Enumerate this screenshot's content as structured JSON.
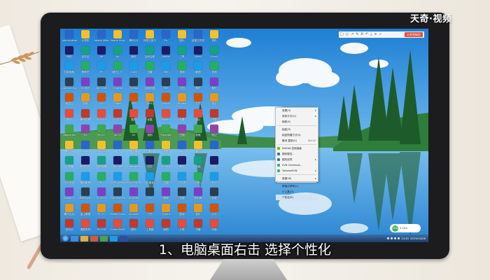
{
  "brand": {
    "logo_text": "天奇·视频"
  },
  "caption": "1、电脑桌面右击 选择个性化",
  "toolbar": {
    "share_label": "分享到微信"
  },
  "taskbar": {
    "clock_time": "14:45",
    "clock_date": "2019/10/26",
    "apps": [
      "ie",
      "explorer",
      "media",
      "chrome",
      "qq",
      "photoshop"
    ]
  },
  "widget": {
    "speed": "25%",
    "net": "0.1K/s"
  },
  "context_menu": {
    "items": [
      {
        "label": "查看(V)",
        "submenu": true
      },
      {
        "label": "排序方式(O)",
        "submenu": true
      },
      {
        "label": "刷新(E)"
      },
      {
        "sep": true
      },
      {
        "label": "粘贴(P)"
      },
      {
        "label": "粘贴快捷方式(S)"
      },
      {
        "label": "撤消 复制(U)",
        "shortcut": "Ctrl+Z"
      },
      {
        "sep": true
      },
      {
        "label": "NVIDIA 控制面板"
      },
      {
        "label": "图形属性..."
      },
      {
        "label": "图形选项",
        "submenu": true
      },
      {
        "label": "SVN Checkout..."
      },
      {
        "label": "TortoiseSVN",
        "submenu": true
      },
      {
        "sep": true
      },
      {
        "label": "新建(W)",
        "submenu": true
      },
      {
        "sep": true
      },
      {
        "label": "屏幕分辨率(C)"
      },
      {
        "label": "小工具(G)"
      },
      {
        "label": "个性化(R)",
        "highlight": true
      }
    ]
  },
  "desktop_icons": [
    "Administrator",
    "计算机",
    "Adobe After Effects",
    "Adobe Illustrator",
    "腾讯QQ",
    "网易云音乐",
    "Ps",
    "图标",
    "新建文件夹",
    "资料",
    "网络",
    "回收站",
    "Ae",
    "Au",
    "微信",
    "会声会影",
    "Adobe",
    "工具",
    "Word",
    "Excel",
    "控制面板",
    "爱奇艺",
    "Pr",
    "格式工厂",
    "CAD",
    "迅雷",
    "360",
    "视频",
    "截图",
    "音频",
    "Internet Explorer",
    "QQ音乐",
    "Ae 2018",
    "Chrome",
    "Firefox",
    "百度网盘",
    "PDF",
    "文档",
    "素材",
    "备份",
    "网易云",
    "剪映",
    "Ai",
    "Edge",
    "PPT",
    "WPS",
    "Xmind",
    "Photos",
    "文件",
    "项目",
    "微信",
    "腾讯视频",
    "Ps 2019",
    "Ai 2019",
    "酷狗",
    "优酷",
    "Steam",
    "设置",
    "图片",
    "下载",
    "Adobe Ae",
    "Ps",
    "Ps CC",
    "Au CC",
    "ID",
    "搜狗",
    "Foxmail",
    "压缩",
    "表格",
    "笔记",
    "腾讯QQ",
    "Premiere",
    "Word 2016",
    "格式",
    "爱剪辑",
    "芒果TV",
    "录屏",
    "演示",
    "课件",
    "临时",
    "计算器",
    "阿里旺旺",
    "视频编辑",
    "Animate",
    "Dreamweaver",
    "钉钉",
    "Camtasia",
    "教程",
    "电脑",
    "网盘",
    "360安全",
    "暴风影音",
    "Br",
    "WPS Office",
    "Excel 2016",
    "AE模板",
    "迅捷",
    "文件夹",
    "归档",
    "其它",
    "Adobe Pr",
    "PotPlayer",
    "Pr 2019",
    "Premiere Pro",
    "ACDSee",
    "UC",
    "微博",
    "快捷",
    "资料库",
    "新建",
    "腾讯会议",
    "金山毒霸",
    "Pr CC",
    "Media Encoder",
    "Acrobat",
    "飞书",
    "Typora",
    "图库",
    "音乐",
    "片头",
    "回收站",
    "美图秀秀",
    "Ps CS6",
    "ScreenToGif",
    "图标",
    "工具箱",
    "画图",
    "片尾",
    "字幕",
    "封面"
  ]
}
